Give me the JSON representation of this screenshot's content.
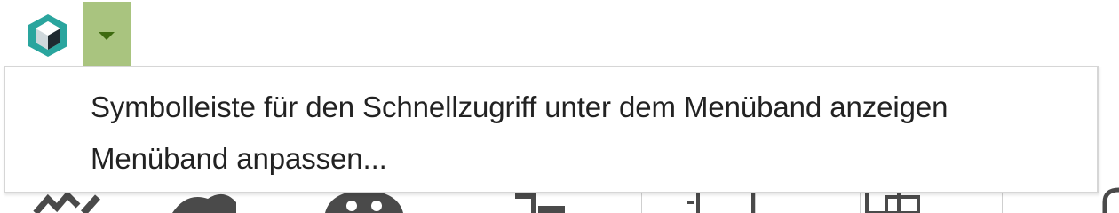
{
  "toolbar": {
    "logo_icon": "app-cube-logo-icon",
    "dropdown_icon": "caret-down-icon",
    "dropdown_color": "#a9c47f",
    "accent_color": "#3e6b10"
  },
  "menu": {
    "items": [
      {
        "label": "Symbolleiste für den Schnellzugriff unter dem Menüband anzeigen"
      },
      {
        "label": "Menüband anpassen..."
      }
    ]
  },
  "ribbon": {
    "icons": [
      "edit-tool-icon",
      "paint-tool-icon",
      "shape-tool-icon",
      "connector-tool-icon",
      "pin-tool-icon",
      "clipboard-tool-icon",
      "link-tool-icon"
    ]
  }
}
